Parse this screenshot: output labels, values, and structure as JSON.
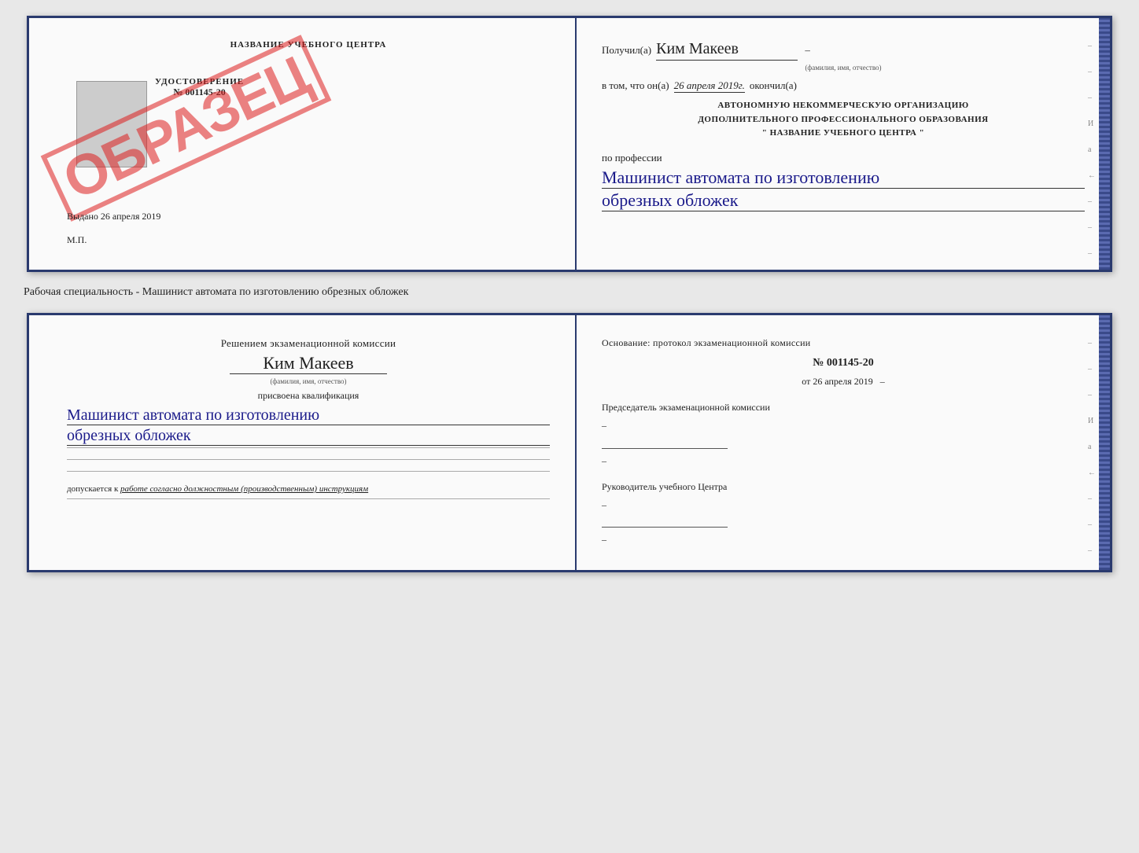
{
  "top_document": {
    "left": {
      "title": "НАЗВАНИЕ УЧЕБНОГО ЦЕНТРА",
      "cert_label": "УДОСТОВЕРЕНИЕ",
      "cert_number": "№ 001145-20",
      "stamp": "ОБРАЗЕЦ",
      "vydano": "Выдано",
      "vydano_date": "26 апреля 2019",
      "mp": "М.П."
    },
    "right": {
      "poluchil": "Получил(а)",
      "recipient_name": "Ким Макеев",
      "fio_sub": "(фамилия, имя, отчество)",
      "v_tom_prefix": "в том, что он(а)",
      "date_handwritten": "26 апреля 2019г.",
      "okonchill": "окончил(а)",
      "org_line1": "АВТОНОМНУЮ НЕКОММЕРЧЕСКУЮ ОРГАНИЗАЦИЮ",
      "org_line2": "ДОПОЛНИТЕЛЬНОГО ПРОФЕССИОНАЛЬНОГО ОБРАЗОВАНИЯ",
      "org_line3": "\" НАЗВАНИЕ УЧЕБНОГО ЦЕНТРА \"",
      "po_professii": "по профессии",
      "profession1": "Машинист автомата по изготовлению",
      "profession2": "обрезных обложек"
    }
  },
  "between_label": "Рабочая специальность - Машинист автомата по изготовлению обрезных обложек",
  "bottom_document": {
    "left": {
      "resheniyem": "Решением экзаменационной комиссии",
      "name": "Ким Макеев",
      "fio_sub": "(фамилия, имя, отчество)",
      "prisvoena": "присвоена квалификация",
      "kvalif1": "Машинист автомата по изготовлению",
      "kvalif2": "обрезных обложек",
      "dopusk_prefix": "допускается к",
      "dopusk_italic": "работе согласно должностным (производственным) инструкциям"
    },
    "right": {
      "osnovanie": "Основание: протокол экзаменационной комиссии",
      "number": "№ 001145-20",
      "ot": "от",
      "ot_date": "26 апреля 2019",
      "predsedatel_label": "Председатель экзаменационной комиссии",
      "rukovoditel_label": "Руководитель учебного Центра"
    }
  },
  "ticks": [
    "-",
    "-",
    "-",
    "И",
    "а",
    "←",
    "-",
    "-",
    "-"
  ]
}
